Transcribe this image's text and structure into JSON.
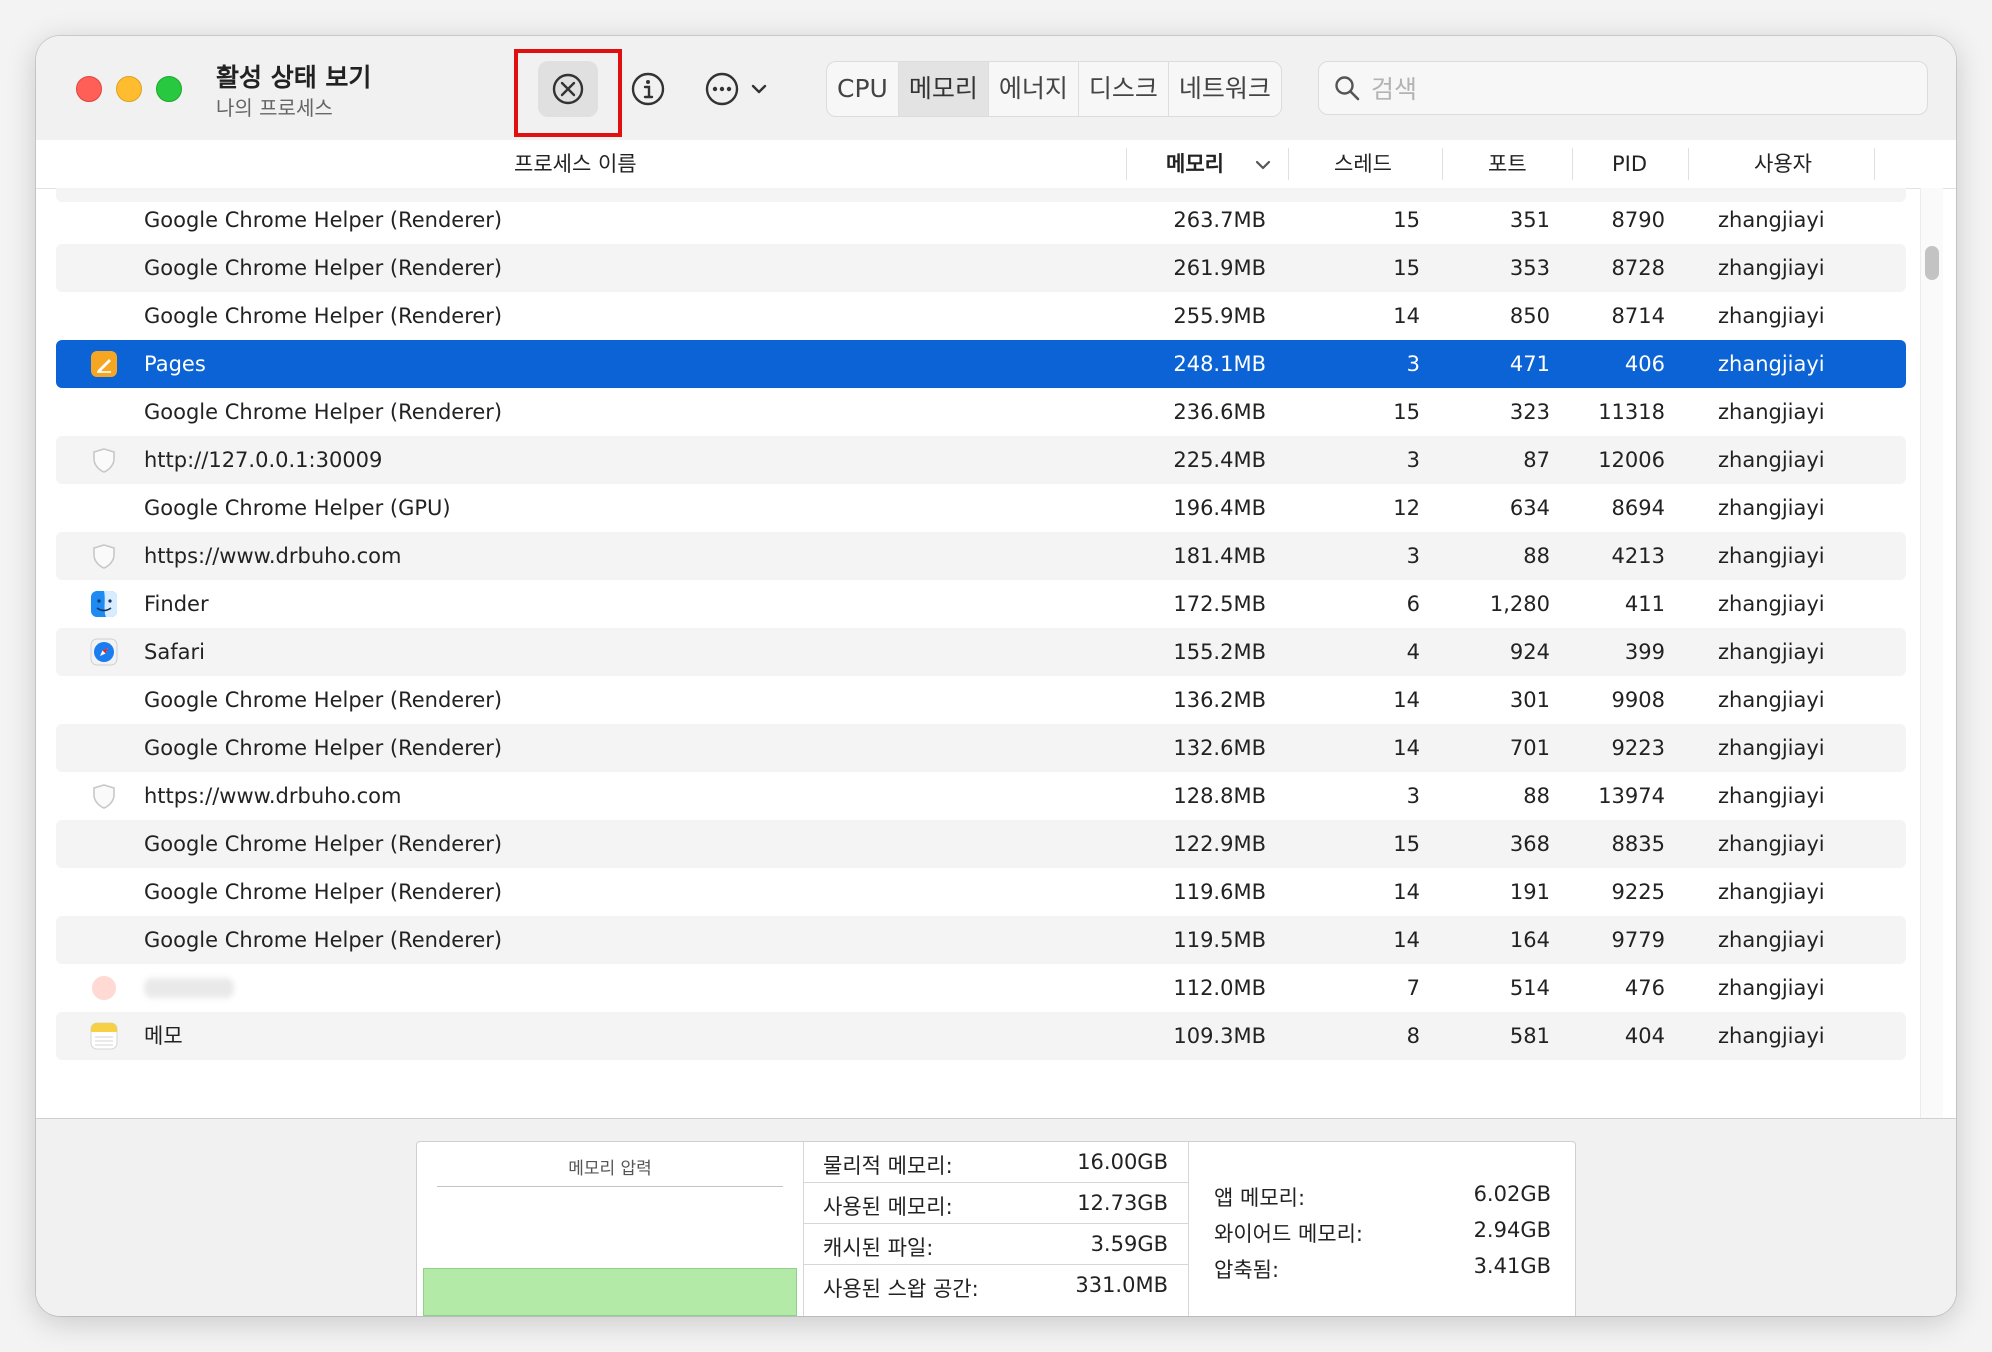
{
  "window": {
    "title": "활성 상태 보기",
    "subtitle": "나의 프로세스"
  },
  "toolbar": {
    "stop_icon": "x-circle-icon",
    "info_icon": "info-icon",
    "more_icon": "ellipsis-circle-icon",
    "tabs": [
      "CPU",
      "메모리",
      "에너지",
      "디스크",
      "네트워크"
    ],
    "active_tab": "메모리",
    "search_placeholder": "검색"
  },
  "columns": {
    "name": "프로세스 이름",
    "memory": "메모리",
    "threads": "스레드",
    "ports": "포트",
    "pid": "PID",
    "user": "사용자"
  },
  "rows": [
    {
      "name": "Google Chrome Helper (Renderer)",
      "memory": "263.7MB",
      "threads": "15",
      "ports": "351",
      "pid": "8790",
      "user": "zhangjiayi",
      "icon": "none"
    },
    {
      "name": "Google Chrome Helper (Renderer)",
      "memory": "261.9MB",
      "threads": "15",
      "ports": "353",
      "pid": "8728",
      "user": "zhangjiayi",
      "icon": "none"
    },
    {
      "name": "Google Chrome Helper (Renderer)",
      "memory": "255.9MB",
      "threads": "14",
      "ports": "850",
      "pid": "8714",
      "user": "zhangjiayi",
      "icon": "none"
    },
    {
      "name": "Pages",
      "memory": "248.1MB",
      "threads": "3",
      "ports": "471",
      "pid": "406",
      "user": "zhangjiayi",
      "icon": "pages-app-icon",
      "selected": true
    },
    {
      "name": "Google Chrome Helper (Renderer)",
      "memory": "236.6MB",
      "threads": "15",
      "ports": "323",
      "pid": "11318",
      "user": "zhangjiayi",
      "icon": "none"
    },
    {
      "name": "http://127.0.0.1:30009",
      "memory": "225.4MB",
      "threads": "3",
      "ports": "87",
      "pid": "12006",
      "user": "zhangjiayi",
      "icon": "shield-icon"
    },
    {
      "name": "Google Chrome Helper (GPU)",
      "memory": "196.4MB",
      "threads": "12",
      "ports": "634",
      "pid": "8694",
      "user": "zhangjiayi",
      "icon": "none"
    },
    {
      "name": "https://www.drbuho.com",
      "memory": "181.4MB",
      "threads": "3",
      "ports": "88",
      "pid": "4213",
      "user": "zhangjiayi",
      "icon": "shield-icon"
    },
    {
      "name": "Finder",
      "memory": "172.5MB",
      "threads": "6",
      "ports": "1,280",
      "pid": "411",
      "user": "zhangjiayi",
      "icon": "finder-app-icon"
    },
    {
      "name": "Safari",
      "memory": "155.2MB",
      "threads": "4",
      "ports": "924",
      "pid": "399",
      "user": "zhangjiayi",
      "icon": "safari-app-icon"
    },
    {
      "name": "Google Chrome Helper (Renderer)",
      "memory": "136.2MB",
      "threads": "14",
      "ports": "301",
      "pid": "9908",
      "user": "zhangjiayi",
      "icon": "none"
    },
    {
      "name": "Google Chrome Helper (Renderer)",
      "memory": "132.6MB",
      "threads": "14",
      "ports": "701",
      "pid": "9223",
      "user": "zhangjiayi",
      "icon": "none"
    },
    {
      "name": "https://www.drbuho.com",
      "memory": "128.8MB",
      "threads": "3",
      "ports": "88",
      "pid": "13974",
      "user": "zhangjiayi",
      "icon": "shield-icon"
    },
    {
      "name": "Google Chrome Helper (Renderer)",
      "memory": "122.9MB",
      "threads": "15",
      "ports": "368",
      "pid": "8835",
      "user": "zhangjiayi",
      "icon": "none"
    },
    {
      "name": "Google Chrome Helper (Renderer)",
      "memory": "119.6MB",
      "threads": "14",
      "ports": "191",
      "pid": "9225",
      "user": "zhangjiayi",
      "icon": "none"
    },
    {
      "name": "Google Chrome Helper (Renderer)",
      "memory": "119.5MB",
      "threads": "14",
      "ports": "164",
      "pid": "9779",
      "user": "zhangjiayi",
      "icon": "none"
    },
    {
      "name": "",
      "memory": "112.0MB",
      "threads": "7",
      "ports": "514",
      "pid": "476",
      "user": "zhangjiayi",
      "icon": "blurred-app-icon"
    },
    {
      "name": "메모",
      "memory": "109.3MB",
      "threads": "8",
      "ports": "581",
      "pid": "404",
      "user": "zhangjiayi",
      "icon": "notes-app-icon"
    }
  ],
  "footer": {
    "pressure_title": "메모리 압력",
    "pressure_color": "#b3eaa8",
    "physical_label": "물리적 메모리:",
    "physical_value": "16.00GB",
    "used_label": "사용된 메모리:",
    "used_value": "12.73GB",
    "cached_label": "캐시된 파일:",
    "cached_value": "3.59GB",
    "swap_label": "사용된 스왑 공간:",
    "swap_value": "331.0MB",
    "app_label": "앱 메모리:",
    "app_value": "6.02GB",
    "wired_label": "와이어드 메모리:",
    "wired_value": "2.94GB",
    "compressed_label": "압축됨:",
    "compressed_value": "3.41GB"
  },
  "colors": {
    "selection": "#0b63d6",
    "highlight": "#e01010"
  }
}
